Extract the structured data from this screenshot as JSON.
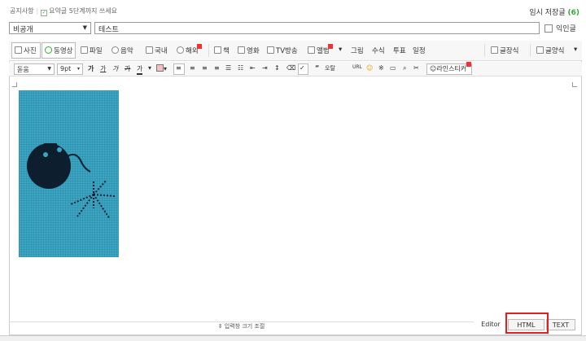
{
  "notice": {
    "label": "공지사항",
    "summary_hint": "요약글 5단계까지 쓰세요"
  },
  "drafts": {
    "label": "임시 저장글",
    "count": "(6)"
  },
  "visibility": {
    "selected": "비공개"
  },
  "title_input": {
    "value": "테스트"
  },
  "anonymous": {
    "label": "익인글"
  },
  "toolbar1": {
    "photo": "사진",
    "video": "동영상",
    "file": "파일",
    "music": "음악",
    "domestic": "국내",
    "overseas": "해외",
    "book": "책",
    "movie": "영화",
    "tv": "TV방송",
    "album": "앨범",
    "graph": "그림",
    "formula": "수식",
    "vote": "투표",
    "schedule": "일정",
    "style1": "글장식",
    "style2": "글양식"
  },
  "toolbar2": {
    "font": "돋움",
    "size": "9pt",
    "bold": "가",
    "underline": "가",
    "italic": "가",
    "strike": "가",
    "color": "가",
    "quote": "“",
    "hanja": "오탈",
    "sticker": "라인스티커"
  },
  "footer": {
    "resize": "⇕ 입력창 크기 조절",
    "tab_editor": "Editor",
    "tab_html": "HTML",
    "tab_text": "TEXT"
  },
  "colors": {
    "accent": "#33aa33",
    "highlight": "#e02020",
    "image_bg": "#3aa6c4"
  }
}
